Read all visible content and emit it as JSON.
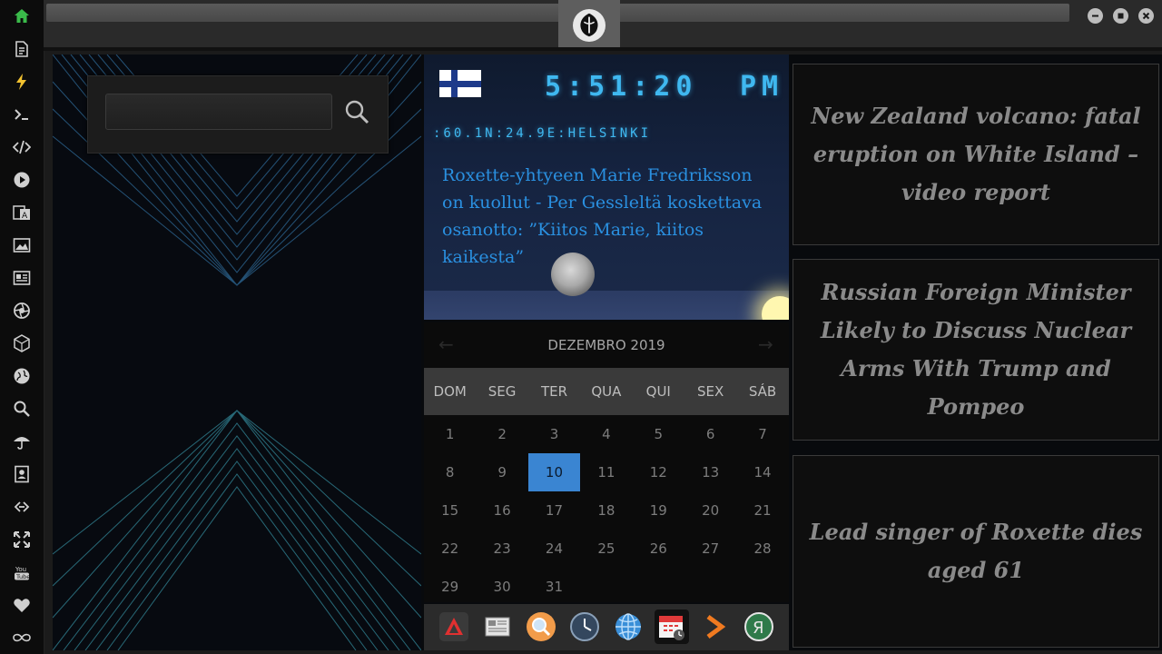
{
  "sidebar": {
    "items": [
      {
        "icon": "home-icon",
        "color": "#3aba4a"
      },
      {
        "icon": "document-icon",
        "color": "#cfcfcf"
      },
      {
        "icon": "lightning-icon",
        "color": "#f2c230"
      },
      {
        "icon": "terminal-icon",
        "color": "#cfcfcf"
      },
      {
        "icon": "code-icon",
        "color": "#cfcfcf"
      },
      {
        "icon": "play-icon",
        "color": "#cfcfcf"
      },
      {
        "icon": "translate-icon",
        "color": "#cfcfcf"
      },
      {
        "icon": "image-icon",
        "color": "#cfcfcf"
      },
      {
        "icon": "news-icon",
        "color": "#cfcfcf"
      },
      {
        "icon": "aperture-icon",
        "color": "#cfcfcf"
      },
      {
        "icon": "cube-icon",
        "color": "#cfcfcf"
      },
      {
        "icon": "globe-icon",
        "color": "#cfcfcf"
      },
      {
        "icon": "search-icon",
        "color": "#cfcfcf"
      },
      {
        "icon": "umbrella-icon",
        "color": "#cfcfcf"
      },
      {
        "icon": "contacts-icon",
        "color": "#cfcfcf"
      },
      {
        "icon": "link-icon",
        "color": "#cfcfcf"
      },
      {
        "icon": "expand-icon",
        "color": "#cfcfcf"
      },
      {
        "icon": "youtube-icon",
        "color": "#cfcfcf"
      },
      {
        "icon": "heart-icon",
        "color": "#cfcfcf"
      },
      {
        "icon": "infinity-icon",
        "color": "#cfcfcf"
      }
    ]
  },
  "topbar": {
    "tab_icon": "rebel-alliance-icon"
  },
  "search": {
    "value": "",
    "placeholder": ""
  },
  "clock": {
    "time": "5:51:20",
    "ampm": "PM",
    "location": ":60.1N:24.9E:HELSINKI",
    "flag": "finland-flag",
    "headline": "Roxette-yhtyeen Marie Fredriksson on kuollut - Per Gessleltä koskettava osanotto: ”Kiitos Marie, kiitos kaikesta”"
  },
  "calendar": {
    "month": "DEZEMBRO 2019",
    "prev": "←",
    "next": "→",
    "weekdays": [
      "DOM",
      "SEG",
      "TER",
      "QUA",
      "QUI",
      "SEX",
      "SÁB"
    ],
    "weeks": [
      [
        "1",
        "2",
        "3",
        "4",
        "5",
        "6",
        "7"
      ],
      [
        "8",
        "9",
        "10",
        "11",
        "12",
        "13",
        "14"
      ],
      [
        "15",
        "16",
        "17",
        "18",
        "19",
        "20",
        "21"
      ],
      [
        "22",
        "23",
        "24",
        "25",
        "26",
        "27",
        "28"
      ],
      [
        "29",
        "30",
        "31",
        "",
        "",
        "",
        ""
      ]
    ],
    "today": "10"
  },
  "dock": {
    "items": [
      {
        "icon": "red-triangle-app-icon"
      },
      {
        "icon": "newspaper-app-icon"
      },
      {
        "icon": "magnifier-app-icon"
      },
      {
        "icon": "clock-app-icon"
      },
      {
        "icon": "web-browser-icon"
      },
      {
        "icon": "calendar-app-icon",
        "active": true
      },
      {
        "icon": "terminal-arrow-icon"
      },
      {
        "icon": "yandex-icon"
      }
    ]
  },
  "news": [
    {
      "headline": "New Zealand volcano: fatal eruption on White Island – video report"
    },
    {
      "headline": "Russian Foreign Minister Likely to Discuss Nuclear Arms With Trump and Pompeo"
    },
    {
      "headline": "Lead singer of Roxette dies aged 61"
    }
  ]
}
